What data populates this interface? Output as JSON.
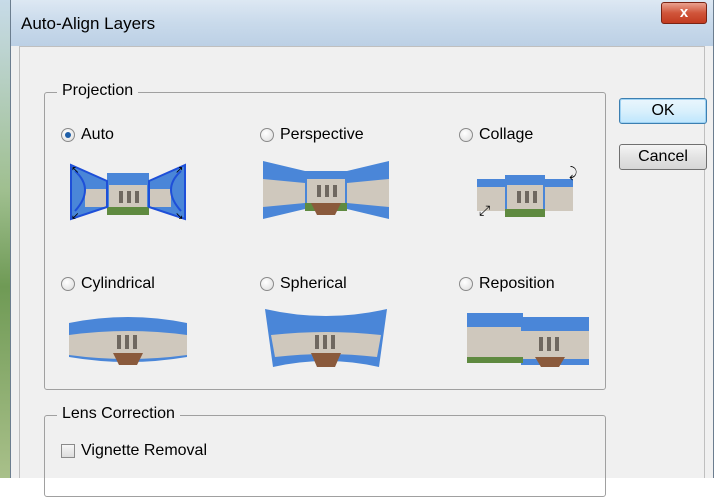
{
  "window": {
    "title": "Auto-Align Layers",
    "close_label": "x"
  },
  "projection": {
    "legend": "Projection",
    "options": [
      {
        "label": "Auto",
        "selected": true
      },
      {
        "label": "Perspective",
        "selected": false
      },
      {
        "label": "Collage",
        "selected": false
      },
      {
        "label": "Cylindrical",
        "selected": false
      },
      {
        "label": "Spherical",
        "selected": false
      },
      {
        "label": "Reposition",
        "selected": false
      }
    ]
  },
  "lens_correction": {
    "legend": "Lens Correction",
    "vignette_label": "Vignette Removal",
    "vignette_checked": false
  },
  "buttons": {
    "ok": "OK",
    "cancel": "Cancel"
  },
  "colors": {
    "sky": "#4a86d8",
    "building": "#cfc8bd",
    "grass": "#5f8a40",
    "path": "#8a5a3c",
    "handle": "#1e4fd8"
  }
}
